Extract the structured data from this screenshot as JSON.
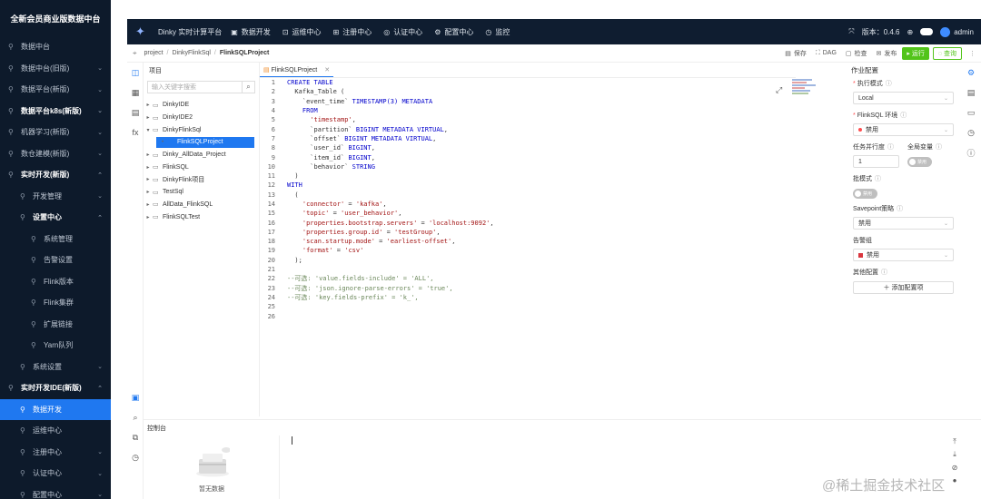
{
  "sidebar": {
    "title": "全新会员商业版数据中台",
    "items": [
      {
        "label": "数据中台",
        "arrow": "",
        "cls": ""
      },
      {
        "label": "数据中台(旧版)",
        "arrow": "⌄",
        "cls": ""
      },
      {
        "label": "数据平台(新版)",
        "arrow": "⌄",
        "cls": ""
      },
      {
        "label": "数据平台k8s(新版)",
        "arrow": "⌄",
        "cls": "bold"
      },
      {
        "label": "机器学习(新版)",
        "arrow": "⌄",
        "cls": ""
      },
      {
        "label": "数仓建模(新版)",
        "arrow": "⌄",
        "cls": ""
      },
      {
        "label": "实时开发(新版)",
        "arrow": "⌃",
        "cls": "bold"
      },
      {
        "label": "开发管理",
        "arrow": "⌄",
        "cls": "lvl2"
      },
      {
        "label": "设置中心",
        "arrow": "⌃",
        "cls": "lvl2 bold"
      },
      {
        "label": "系统管理",
        "arrow": "",
        "cls": "lvl3"
      },
      {
        "label": "告警设置",
        "arrow": "",
        "cls": "lvl3"
      },
      {
        "label": "Flink版本",
        "arrow": "",
        "cls": "lvl3"
      },
      {
        "label": "Flink集群",
        "arrow": "",
        "cls": "lvl3"
      },
      {
        "label": "扩展链接",
        "arrow": "",
        "cls": "lvl3"
      },
      {
        "label": "Yarn队列",
        "arrow": "",
        "cls": "lvl3"
      },
      {
        "label": "系统设置",
        "arrow": "⌄",
        "cls": "lvl2"
      },
      {
        "label": "实时开发IDE(新版)",
        "arrow": "⌃",
        "cls": "bold"
      },
      {
        "label": "数据开发",
        "arrow": "",
        "cls": "lvl2 active"
      },
      {
        "label": "运维中心",
        "arrow": "",
        "cls": "lvl2"
      },
      {
        "label": "注册中心",
        "arrow": "⌄",
        "cls": "lvl2"
      },
      {
        "label": "认证中心",
        "arrow": "⌄",
        "cls": "lvl2"
      },
      {
        "label": "配置中心",
        "arrow": "⌄",
        "cls": "lvl2"
      }
    ]
  },
  "topbar": {
    "title": "Dinky 实时计算平台",
    "nav": [
      {
        "label": "数据开发",
        "icon": "▣"
      },
      {
        "label": "运维中心",
        "icon": "⊡"
      },
      {
        "label": "注册中心",
        "icon": "⊞"
      },
      {
        "label": "认证中心",
        "icon": "◎"
      },
      {
        "label": "配置中心",
        "icon": "⚙"
      },
      {
        "label": "监控",
        "icon": "◷"
      }
    ],
    "version": "版本：0.4.6",
    "user": "admin"
  },
  "breadcrumb": {
    "items": [
      "project",
      "DinkyFlinkSql",
      "FlinkSQLProject"
    ]
  },
  "actions": {
    "save": "保存",
    "dag": "DAG",
    "check": "检查",
    "publish": "发布",
    "run": "运行",
    "query": "查询"
  },
  "tree": {
    "header": "项目",
    "search_placeholder": "输入关键字搜索",
    "nodes": [
      {
        "label": "DinkyIDE",
        "level": 0,
        "open": false,
        "selected": false
      },
      {
        "label": "DinkyIDE2",
        "level": 0,
        "open": false,
        "selected": false
      },
      {
        "label": "DinkyFlinkSql",
        "level": 0,
        "open": true,
        "selected": false
      },
      {
        "label": "FlinkSQLProject",
        "level": 1,
        "open": false,
        "selected": true
      },
      {
        "label": "Dinky_AllData_Project",
        "level": 0,
        "open": false,
        "selected": false
      },
      {
        "label": "FlinkSQL",
        "level": 0,
        "open": false,
        "selected": false
      },
      {
        "label": "DinkyFlink项目",
        "level": 0,
        "open": false,
        "selected": false
      },
      {
        "label": "TestSql",
        "level": 0,
        "open": false,
        "selected": false
      },
      {
        "label": "AllData_FlinkSQL",
        "level": 0,
        "open": false,
        "selected": false
      },
      {
        "label": "FlinkSQLTest",
        "level": 0,
        "open": false,
        "selected": false
      }
    ]
  },
  "editor": {
    "tab": "FlinkSQLProject",
    "lines": [
      {
        "n": "1",
        "parts": [
          {
            "t": "CREATE TABLE",
            "c": "kw"
          }
        ]
      },
      {
        "n": "2",
        "parts": [
          {
            "t": "  Kafka_Table (",
            "c": ""
          }
        ]
      },
      {
        "n": "3",
        "parts": [
          {
            "t": "    `event_time` ",
            "c": ""
          },
          {
            "t": "TIMESTAMP(3) METADATA",
            "c": "kw"
          }
        ]
      },
      {
        "n": "4",
        "parts": [
          {
            "t": "    ",
            "c": ""
          },
          {
            "t": "FROM",
            "c": "kw"
          }
        ]
      },
      {
        "n": "5",
        "parts": [
          {
            "t": "      ",
            "c": ""
          },
          {
            "t": "'timestamp'",
            "c": "str"
          },
          {
            "t": ",",
            "c": ""
          }
        ]
      },
      {
        "n": "6",
        "parts": [
          {
            "t": "      `partition` ",
            "c": ""
          },
          {
            "t": "BIGINT METADATA VIRTUAL",
            "c": "kw"
          },
          {
            "t": ",",
            "c": ""
          }
        ]
      },
      {
        "n": "7",
        "parts": [
          {
            "t": "      `offset` ",
            "c": ""
          },
          {
            "t": "BIGINT METADATA VIRTUAL",
            "c": "kw"
          },
          {
            "t": ",",
            "c": ""
          }
        ]
      },
      {
        "n": "8",
        "parts": [
          {
            "t": "      `user_id` ",
            "c": ""
          },
          {
            "t": "BIGINT",
            "c": "kw"
          },
          {
            "t": ",",
            "c": ""
          }
        ]
      },
      {
        "n": "9",
        "parts": [
          {
            "t": "      `item_id` ",
            "c": ""
          },
          {
            "t": "BIGINT",
            "c": "kw"
          },
          {
            "t": ",",
            "c": ""
          }
        ]
      },
      {
        "n": "10",
        "parts": [
          {
            "t": "      `behavior` ",
            "c": ""
          },
          {
            "t": "STRING",
            "c": "kw"
          }
        ]
      },
      {
        "n": "11",
        "parts": [
          {
            "t": "  )",
            "c": ""
          }
        ]
      },
      {
        "n": "12",
        "parts": [
          {
            "t": "WITH",
            "c": "kw"
          }
        ]
      },
      {
        "n": "13",
        "parts": [
          {
            "t": "  (",
            "c": ""
          }
        ]
      },
      {
        "n": "14",
        "parts": [
          {
            "t": "    ",
            "c": ""
          },
          {
            "t": "'connector'",
            "c": "str"
          },
          {
            "t": " = ",
            "c": ""
          },
          {
            "t": "'kafka'",
            "c": "str"
          },
          {
            "t": ",",
            "c": ""
          }
        ]
      },
      {
        "n": "15",
        "parts": [
          {
            "t": "    ",
            "c": ""
          },
          {
            "t": "'topic'",
            "c": "str"
          },
          {
            "t": " = ",
            "c": ""
          },
          {
            "t": "'user_behavior'",
            "c": "str"
          },
          {
            "t": ",",
            "c": ""
          }
        ]
      },
      {
        "n": "16",
        "parts": [
          {
            "t": "    ",
            "c": ""
          },
          {
            "t": "'properties.bootstrap.servers'",
            "c": "str"
          },
          {
            "t": " = ",
            "c": ""
          },
          {
            "t": "'localhost:9092'",
            "c": "str"
          },
          {
            "t": ",",
            "c": ""
          }
        ]
      },
      {
        "n": "17",
        "parts": [
          {
            "t": "    ",
            "c": ""
          },
          {
            "t": "'properties.group.id'",
            "c": "str"
          },
          {
            "t": " = ",
            "c": ""
          },
          {
            "t": "'testGroup'",
            "c": "str"
          },
          {
            "t": ",",
            "c": ""
          }
        ]
      },
      {
        "n": "18",
        "parts": [
          {
            "t": "    ",
            "c": ""
          },
          {
            "t": "'scan.startup.mode'",
            "c": "str"
          },
          {
            "t": " = ",
            "c": ""
          },
          {
            "t": "'earliest-offset'",
            "c": "str"
          },
          {
            "t": ",",
            "c": ""
          }
        ]
      },
      {
        "n": "19",
        "parts": [
          {
            "t": "    ",
            "c": ""
          },
          {
            "t": "'format'",
            "c": "str"
          },
          {
            "t": " = ",
            "c": ""
          },
          {
            "t": "'csv'",
            "c": "str"
          }
        ]
      },
      {
        "n": "20",
        "parts": [
          {
            "t": "  );",
            "c": ""
          }
        ]
      },
      {
        "n": "21",
        "parts": [
          {
            "t": "",
            "c": ""
          }
        ]
      },
      {
        "n": "22",
        "parts": [
          {
            "t": "--可选: 'value.fields-include' = 'ALL',",
            "c": "cmt"
          }
        ]
      },
      {
        "n": "23",
        "parts": [
          {
            "t": "--可选: 'json.ignore-parse-errors' = 'true',",
            "c": "cmt"
          }
        ]
      },
      {
        "n": "24",
        "parts": [
          {
            "t": "--可选: 'key.fields-prefix' = 'k_',",
            "c": "cmt"
          }
        ]
      },
      {
        "n": "25",
        "parts": [
          {
            "t": "",
            "c": ""
          }
        ]
      },
      {
        "n": "26",
        "parts": [
          {
            "t": "",
            "c": ""
          }
        ]
      }
    ]
  },
  "config": {
    "title": "作业配置",
    "exec_mode_label": "执行模式",
    "exec_mode_value": "Local",
    "env_label": "FlinkSQL 环境",
    "env_value": "禁用",
    "parallel_label": "任务并行度",
    "parallel_value": "1",
    "global_var_label": "全局变量",
    "global_var_switch": "禁用",
    "batch_label": "批模式",
    "batch_switch": "禁用",
    "savepoint_label": "Savepoint策略",
    "savepoint_value": "禁用",
    "alert_label": "告警组",
    "alert_value": "禁用",
    "other_label": "其他配置",
    "add_config": "添加配置项"
  },
  "console": {
    "title": "控制台",
    "empty": "暂无数据"
  },
  "watermark": "@稀土掘金技术社区",
  "colors": {
    "accent": "#1f78f0",
    "sidebar_bg": "#0d1a2b",
    "run_green": "#52c41a"
  }
}
